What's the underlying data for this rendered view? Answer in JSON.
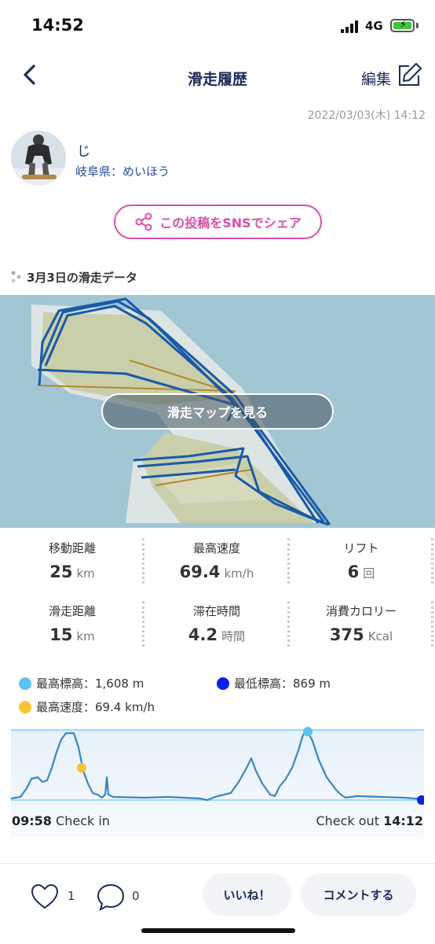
{
  "status_bar": {
    "time": "14:52",
    "network": "4G"
  },
  "header": {
    "title": "滑走履歴",
    "edit_label": "編集"
  },
  "post": {
    "date": "2022/03/03(木) 14:12",
    "user_name": "じ",
    "location": "岐阜県：めいほう"
  },
  "share_button": {
    "label": "この投稿をSNSでシェア"
  },
  "section": {
    "title": "3月3日の滑走データ"
  },
  "map": {
    "button_label": "滑走マップを見る"
  },
  "stats": [
    {
      "label": "移動距離",
      "value": "25",
      "unit": "km"
    },
    {
      "label": "最高速度",
      "value": "69.4",
      "unit": "km/h"
    },
    {
      "label": "リフト",
      "value": "6",
      "unit": "回"
    },
    {
      "label": "滑走距離",
      "value": "15",
      "unit": "km"
    },
    {
      "label": "滞在時間",
      "value": "4.2",
      "unit": "時間"
    },
    {
      "label": "消費カロリー",
      "value": "375",
      "unit": "Kcal"
    }
  ],
  "legend": {
    "max_alt": "最高標高：1,608 m",
    "min_alt": "最低標高：869 m",
    "max_speed": "最高速度：69.4 km/h"
  },
  "timeline": {
    "start_time": "09:58",
    "start_label": "Check in",
    "end_label": "Check out",
    "end_time": "14:12"
  },
  "actions": {
    "like_count": "1",
    "comment_count": "0",
    "like_button": "いいね！",
    "comment_button": "コメントする"
  },
  "colors": {
    "navy": "#1c2a59",
    "pink": "#d84fa9",
    "max_alt": "#5bc3ef",
    "min_alt": "#0a1ee8",
    "speed": "#f5c430",
    "line": "#3a86c2"
  }
}
